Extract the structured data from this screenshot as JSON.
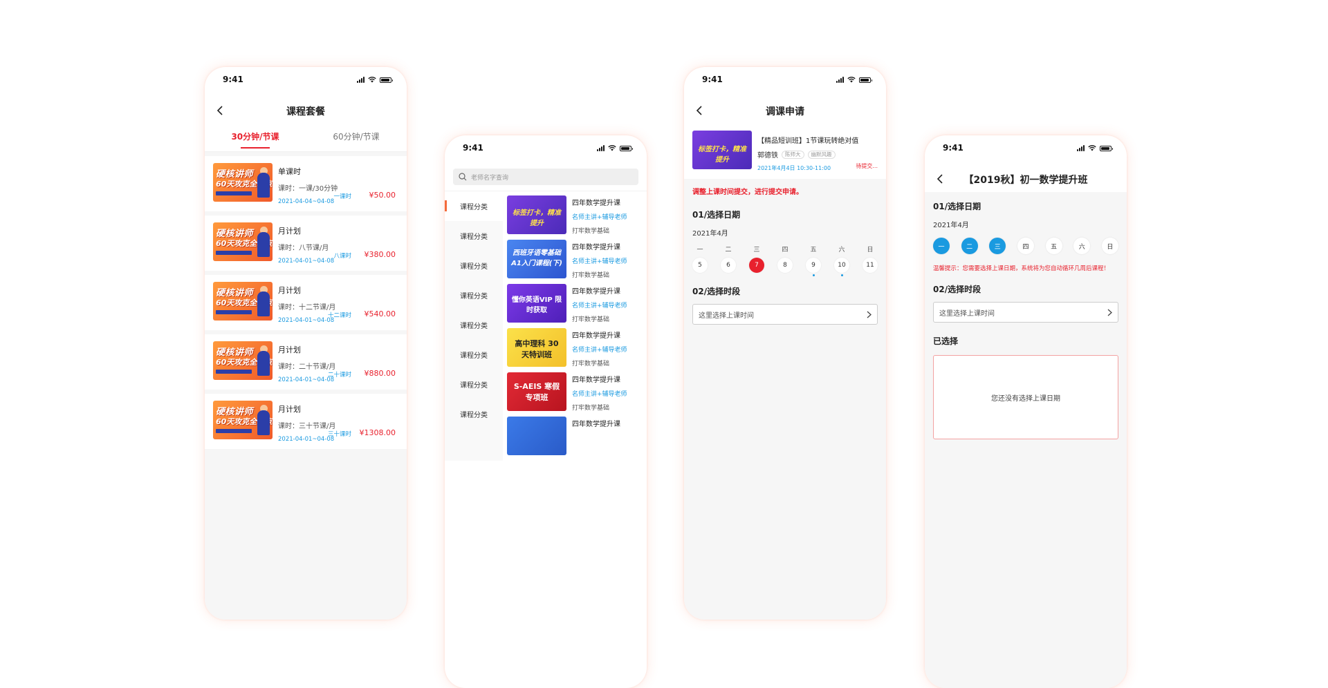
{
  "status_time": "9:41",
  "phone1": {
    "title": "课程套餐",
    "tabs": [
      "30分钟/节课",
      "60分钟/节课"
    ],
    "promo": {
      "line1": "硬核讲师",
      "line2": "60天攻克全考点"
    },
    "packages": [
      {
        "name": "单课时",
        "sub": "课时：一课/30分钟",
        "date": "2021-04-04~04-08",
        "count": "一课时",
        "price": "¥50.00"
      },
      {
        "name": "月计划",
        "sub": "课时：八节课/月",
        "date": "2021-04-01~04-08",
        "count": "八课时",
        "price": "¥380.00"
      },
      {
        "name": "月计划",
        "sub": "课时：十二节课/月",
        "date": "2021-04-01~04-08",
        "count": "十二课时",
        "price": "¥540.00"
      },
      {
        "name": "月计划",
        "sub": "课时：二十节课/月",
        "date": "2021-04-01~04-08",
        "count": "二十课时",
        "price": "¥880.00"
      },
      {
        "name": "月计划",
        "sub": "课时：三十节课/月",
        "date": "2021-04-01~04-08",
        "count": "三十课时",
        "price": "¥1308.00"
      }
    ]
  },
  "phone2": {
    "search_placeholder": "老师名字查询",
    "categories": [
      "课程分类",
      "课程分类",
      "课程分类",
      "课程分类",
      "课程分类",
      "课程分类",
      "课程分类",
      "课程分类"
    ],
    "courses": [
      {
        "thumb_text": "标签打卡，精准提升",
        "name": "四年数学提升课",
        "teacher": "名师主讲+辅导老师",
        "base": "打牢数学基础",
        "bg": "#6a3bd8"
      },
      {
        "thumb_text": "西班牙语零基础 A1入门课程(下)",
        "name": "四年数学提升课",
        "teacher": "名师主讲+辅导老师",
        "base": "打牢数学基础",
        "bg": "#2f6fe0"
      },
      {
        "thumb_text": "懂你英语VIP 限时获取",
        "name": "四年数学提升课",
        "teacher": "名师主讲+辅导老师",
        "base": "打牢数学基础",
        "bg": "#6b2fd8"
      },
      {
        "thumb_text": "高中理科 30天特训班",
        "name": "四年数学提升课",
        "teacher": "名师主讲+辅导老师",
        "base": "打牢数学基础",
        "bg": "#f6d33a"
      },
      {
        "thumb_text": "S-AEIS 寒假专项班",
        "name": "四年数学提升课",
        "teacher": "名师主讲+辅导老师",
        "base": "打牢数学基础",
        "bg": "#d8232f"
      },
      {
        "thumb_text": "",
        "name": "四年数学提升课",
        "teacher": "",
        "base": "",
        "bg": "#2f6fe0"
      }
    ]
  },
  "phone3": {
    "title": "调课申请",
    "card": {
      "thumb_text": "标签打卡，精准提升",
      "name": "【精品短训班】1节课玩转绝对值",
      "teacher": "郭德铁",
      "tags": [
        "陈师大",
        "幽默风趣"
      ],
      "date": "2021年4月4日  10:30-11:00",
      "status": "待提交..."
    },
    "red_note": "调整上课时间提交，进行提交申请。",
    "section_date": "01/选择日期",
    "month": "2021年4月",
    "weekdays": [
      "一",
      "二",
      "三",
      "四",
      "五",
      "六",
      "日"
    ],
    "days": [
      "5",
      "6",
      "7",
      "8",
      "9",
      "10",
      "11"
    ],
    "selected_day": "7",
    "section_time": "02/选择时段",
    "time_placeholder": "这里选择上课时间"
  },
  "phone4": {
    "title": "【2019秋】初一数学提升班",
    "section_date": "01/选择日期",
    "month": "2021年4月",
    "weekdays": [
      "一",
      "二",
      "三",
      "四",
      "五",
      "六",
      "日"
    ],
    "selected_count": 3,
    "hint": "温馨提示：您需要选择上课日期，系统将为您自动循环几周后课程！",
    "section_time": "02/选择时段",
    "time_placeholder": "这里选择上课时间",
    "section_chosen": "已选择",
    "empty_text": "您还没有选择上课日期"
  },
  "colors": {
    "accent_red": "#e8212d",
    "accent_blue": "#1a9ae0"
  }
}
